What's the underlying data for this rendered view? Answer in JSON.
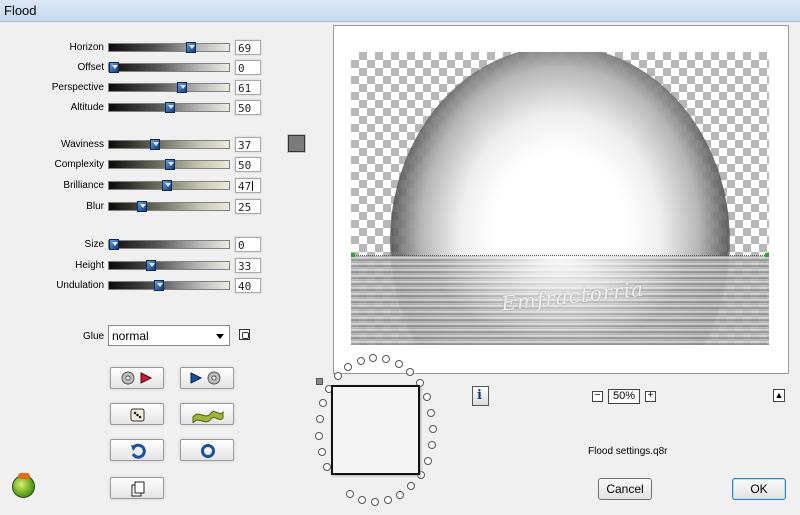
{
  "window": {
    "title": "Flood"
  },
  "params": [
    {
      "key": "horizon",
      "label": "Horizon",
      "value": "69",
      "level": 69,
      "style": "gray"
    },
    {
      "key": "offset",
      "label": "Offset",
      "value": "0",
      "level": 0,
      "style": "gray"
    },
    {
      "key": "perspective",
      "label": "Perspective",
      "value": "61",
      "level": 61,
      "style": "gray"
    },
    {
      "key": "altitude",
      "label": "Altitude",
      "value": "50",
      "level": 50,
      "style": "gray"
    },
    {
      "key": "waviness",
      "label": "Waviness",
      "value": "37",
      "level": 37,
      "style": "cream"
    },
    {
      "key": "complexity",
      "label": "Complexity",
      "value": "50",
      "level": 50,
      "style": "cream"
    },
    {
      "key": "brilliance",
      "label": "Brilliance",
      "value": "47",
      "level": 47,
      "style": "cream",
      "active": true
    },
    {
      "key": "blur",
      "label": "Blur",
      "value": "25",
      "level": 25,
      "style": "cream"
    },
    {
      "key": "size",
      "label": "Size",
      "value": "0",
      "level": 0,
      "style": "gray"
    },
    {
      "key": "height",
      "label": "Height",
      "value": "33",
      "level": 33,
      "style": "gray"
    },
    {
      "key": "undulation",
      "label": "Undulation",
      "value": "40",
      "level": 40,
      "style": "gray"
    }
  ],
  "flood_color": "#7b7b7b",
  "glue": {
    "label": "Glue",
    "value": "normal"
  },
  "tools": [
    {
      "key": "load",
      "icon": "disc-load-icon"
    },
    {
      "key": "play",
      "icon": "play-save-icon"
    },
    {
      "key": "random",
      "icon": "dice-icon"
    },
    {
      "key": "ribbon",
      "icon": "ribbon-icon"
    },
    {
      "key": "reset",
      "icon": "reset-arrow-icon"
    },
    {
      "key": "cycle",
      "icon": "cycle-icon"
    },
    {
      "key": "copy",
      "icon": "copy-pages-icon"
    }
  ],
  "preview": {
    "watermark": "Emfractorria"
  },
  "zoom": {
    "value": "50%"
  },
  "settings_file": "Flood settings.q8r",
  "buttons": {
    "cancel": "Cancel",
    "ok": "OK"
  },
  "colors": {
    "accent": "#1a3b8a",
    "horizon_marker": "#2aaa2a",
    "titlebar": "#c5d9ef"
  }
}
